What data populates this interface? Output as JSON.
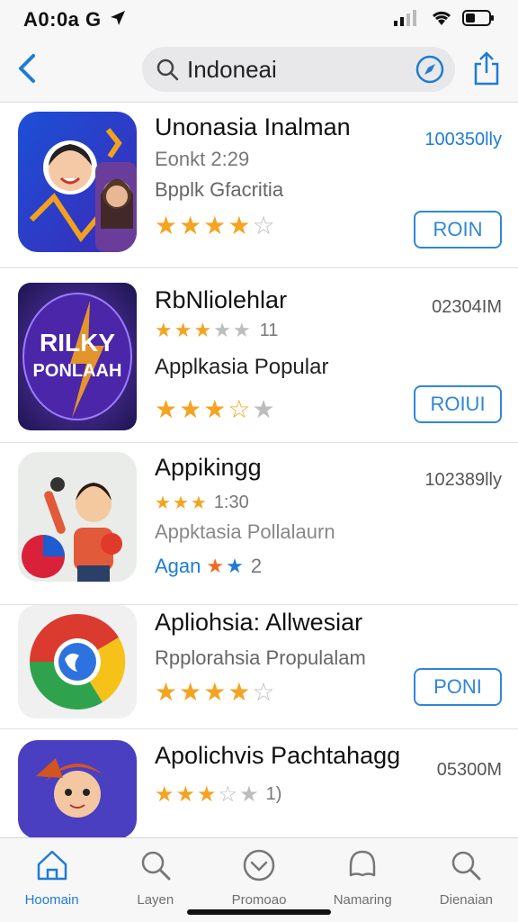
{
  "status_bar": {
    "time": "A0:0a G"
  },
  "search": {
    "query": "Indoneai"
  },
  "apps": [
    {
      "name": "Unonasia Inalman",
      "line2": "Eonkt 2:29",
      "line3": "Bpplk Gfacritia",
      "rating": 4,
      "size": "100350lly",
      "get_label": "ROIN"
    },
    {
      "name": "RbNliolehlar",
      "line2_suffix": "11",
      "line2_rating": 3,
      "line3": "Applkasia Popular",
      "rating": 3.5,
      "size": "02304IM",
      "icon_text_top": "RILKY",
      "icon_text_bottom": "PONLAAH",
      "get_label": "ROIUI"
    },
    {
      "name": "Appikingg",
      "line2": "1:30",
      "line2_rating": 3,
      "line3": "Appktasia Pollalaurn",
      "line4_prefix": "Agan",
      "line4_suffix": "2",
      "size": "102389lly"
    },
    {
      "name": "Apliohsia: Allwesiar",
      "line2": "Rpplorahsia Propulalam",
      "rating": 4,
      "size": "",
      "get_label": "PONI"
    },
    {
      "name": "Apolichvis Pachtahagg",
      "line2_suffix": "1)",
      "rating": 3.5,
      "size": "05300M"
    }
  ],
  "tabs": [
    {
      "label": "Hoomain",
      "icon": "home-icon"
    },
    {
      "label": "Layen",
      "icon": "search-icon"
    },
    {
      "label": "Promoao",
      "icon": "chevron-circle-icon"
    },
    {
      "label": "Namaring",
      "icon": "bubble-icon"
    },
    {
      "label": "Dienaian",
      "icon": "search-icon"
    }
  ],
  "colors": {
    "accent": "#1e7cd3",
    "star": "#f5a320"
  }
}
